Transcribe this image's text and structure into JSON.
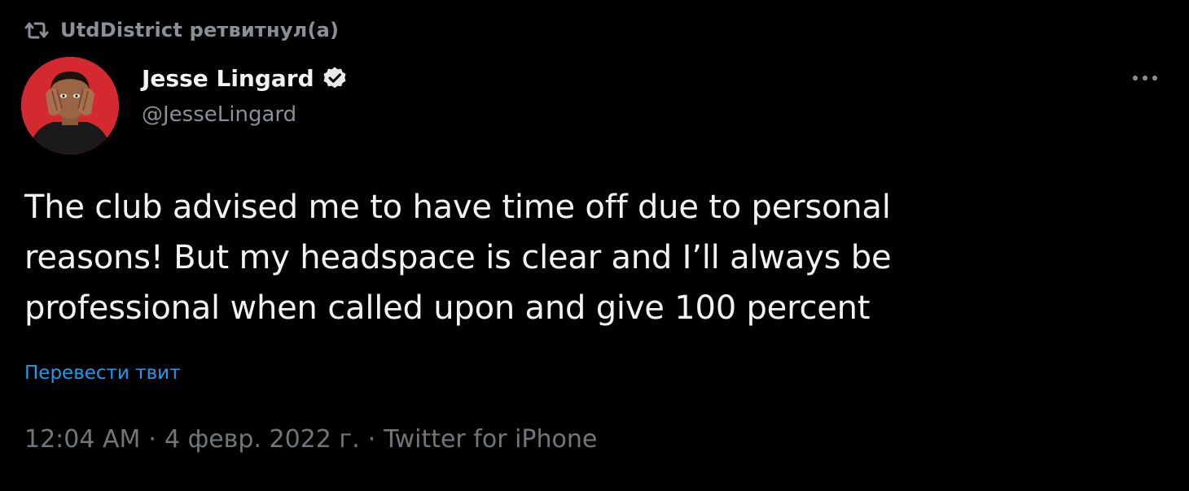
{
  "retweet": {
    "label": "UtdDistrict ретвитнул(а)"
  },
  "author": {
    "display_name": "Jesse Lingard",
    "handle": "@JesseLingard",
    "verified": true,
    "avatar_icon": "avatar-photo"
  },
  "tweet": {
    "text": "The club advised me to have time off due to personal\nreasons! But my headspace is clear and I’ll always be\nprofessional when called upon and give 100 percent",
    "translate_label": "Перевести твит"
  },
  "meta": {
    "time": "12:04 AM",
    "separator": "·",
    "date": "4 февр. 2022 г.",
    "source": "Twitter for iPhone"
  },
  "icons": {
    "retweet": "retweet-icon",
    "verified": "verified-badge-icon",
    "more": "more-options-icon"
  },
  "colors": {
    "background": "#000000",
    "text_primary": "#f0f2f3",
    "text_secondary": "#8b9096",
    "link": "#1d9bf0",
    "avatar_bg": "#d42a2f"
  }
}
